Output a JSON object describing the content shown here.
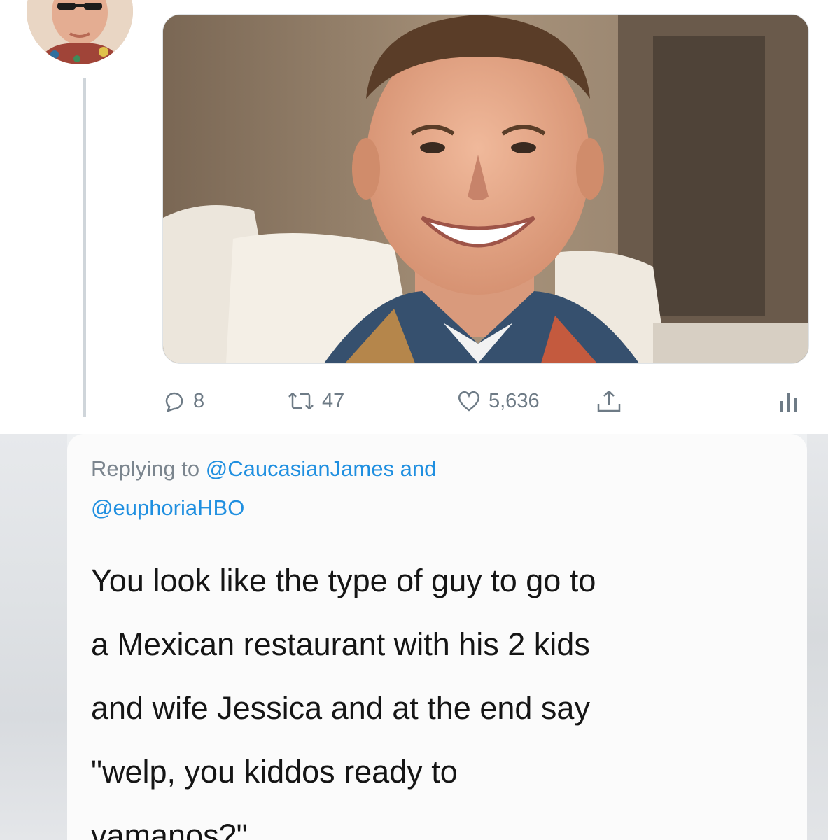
{
  "tweet": {
    "stats": {
      "replies": "8",
      "retweets": "47",
      "likes": "5,636"
    },
    "icons": {
      "reply": "speech-bubble-icon",
      "retweet": "retweet-arrows-icon",
      "like": "heart-icon",
      "share": "share-upload-icon",
      "analytics": "bar-chart-icon"
    }
  },
  "reply": {
    "replying_prefix": "Replying to",
    "mention_1": "@CaucasianJames",
    "joiner": "and",
    "mention_2": "@euphoriaHBO",
    "text_lines": [
      "You look like the type of guy to go to",
      "a Mexican restaurant with his 2 kids",
      "and wife Jessica and at the end say",
      "\"welp, you kiddos ready to",
      "vamanos?\""
    ]
  },
  "colors": {
    "link": "#1f8fe0",
    "muted": "#6e7b86",
    "text": "#151515",
    "thread_line": "#cfd5da"
  }
}
